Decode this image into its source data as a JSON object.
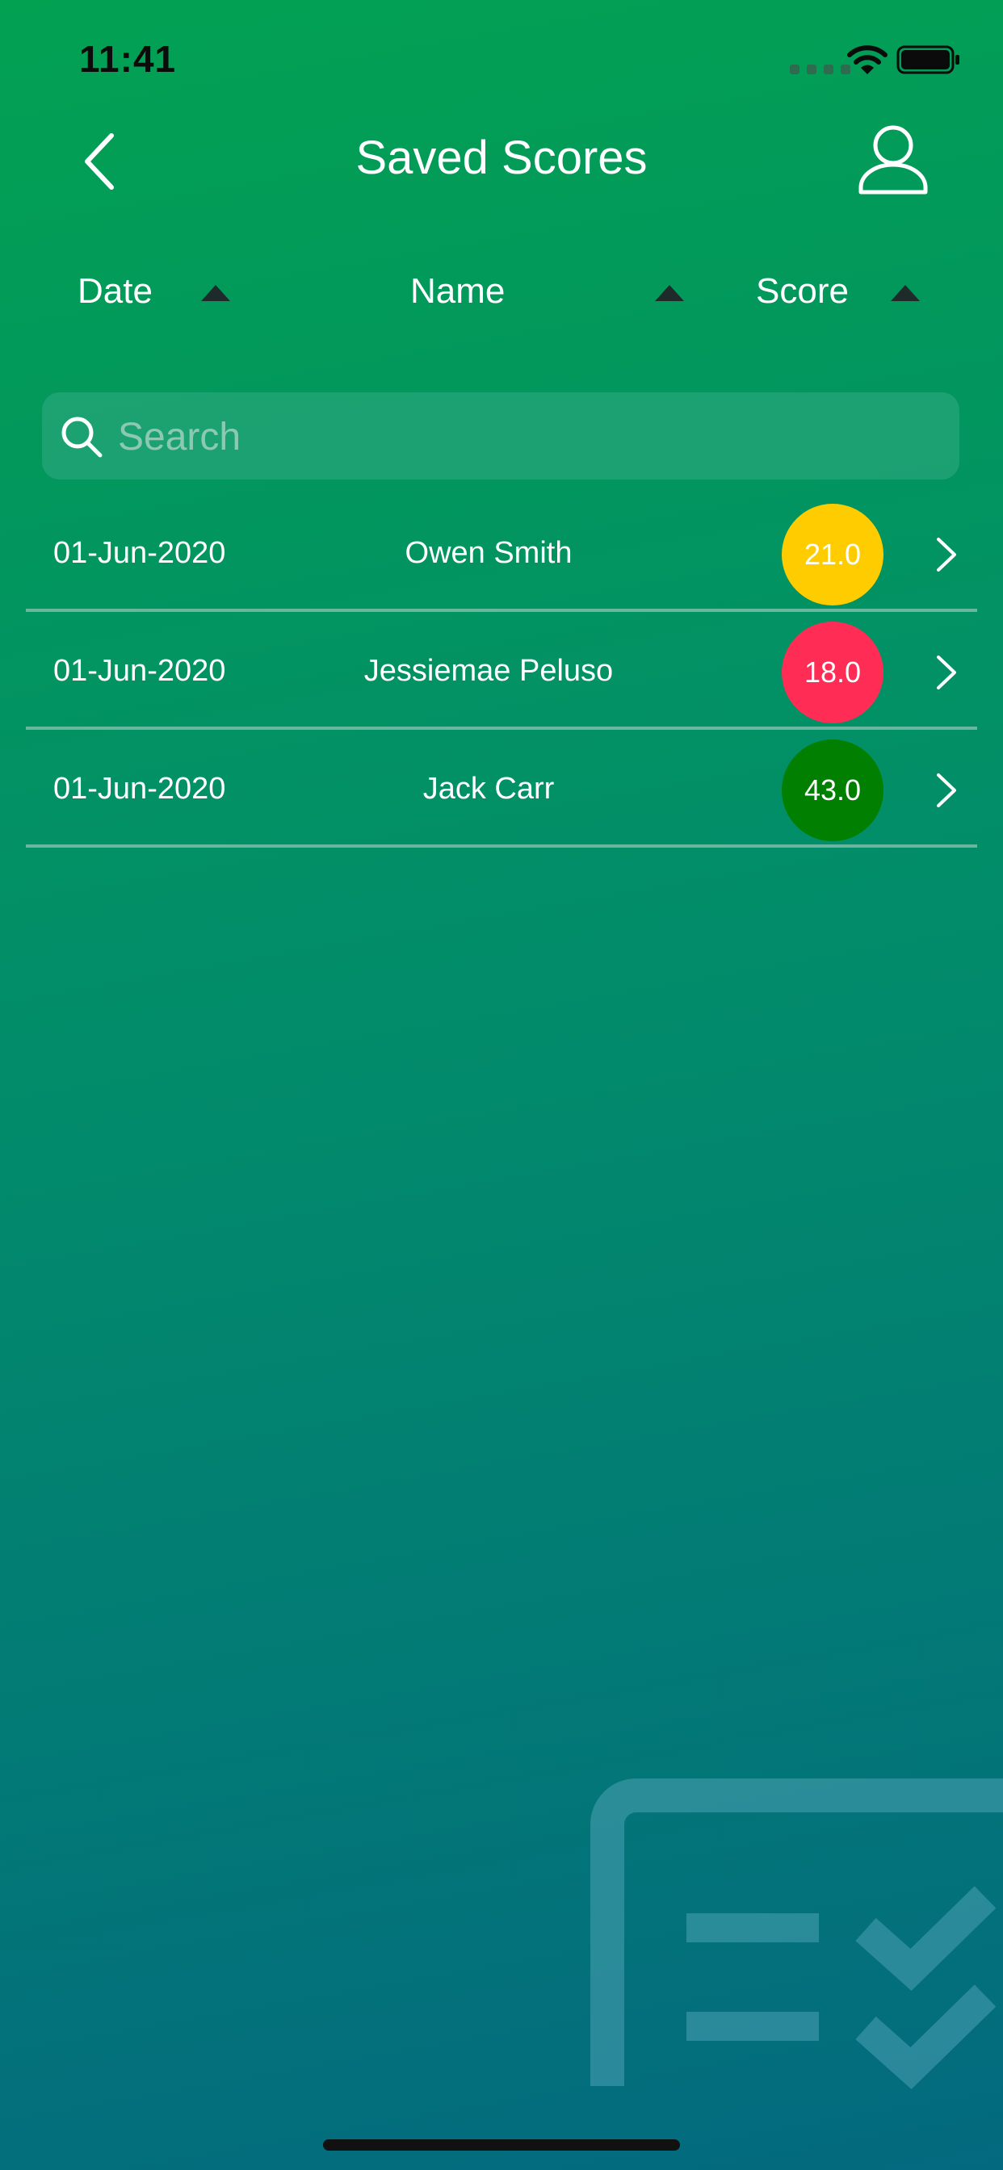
{
  "status_bar": {
    "time": "11:41"
  },
  "nav": {
    "title": "Saved Scores",
    "back_icon": "chevron-left-icon",
    "profile_icon": "user-icon"
  },
  "sort_header": {
    "columns": [
      {
        "label": "Date",
        "direction": "ascending",
        "icon": "triangle-up-icon"
      },
      {
        "label": "Name",
        "direction": "ascending",
        "icon": "triangle-up-icon"
      },
      {
        "label": "Score",
        "direction": "ascending",
        "icon": "triangle-up-icon"
      }
    ]
  },
  "search": {
    "placeholder": "Search",
    "value": ""
  },
  "rows": [
    {
      "date": "01-Jun-2020",
      "name": "Owen Smith",
      "score": "21.0",
      "score_color": "#ffcc00"
    },
    {
      "date": "01-Jun-2020",
      "name": "Jessiemae Peluso",
      "score": "18.0",
      "score_color": "#ff2d55"
    },
    {
      "date": "01-Jun-2020",
      "name": "Jack Carr",
      "score": "43.0",
      "score_color": "#007f00"
    }
  ],
  "colors": {
    "gradient_top": "#02a152",
    "gradient_bottom": "#03697f",
    "sort_arrow": "#1f2a2a"
  }
}
